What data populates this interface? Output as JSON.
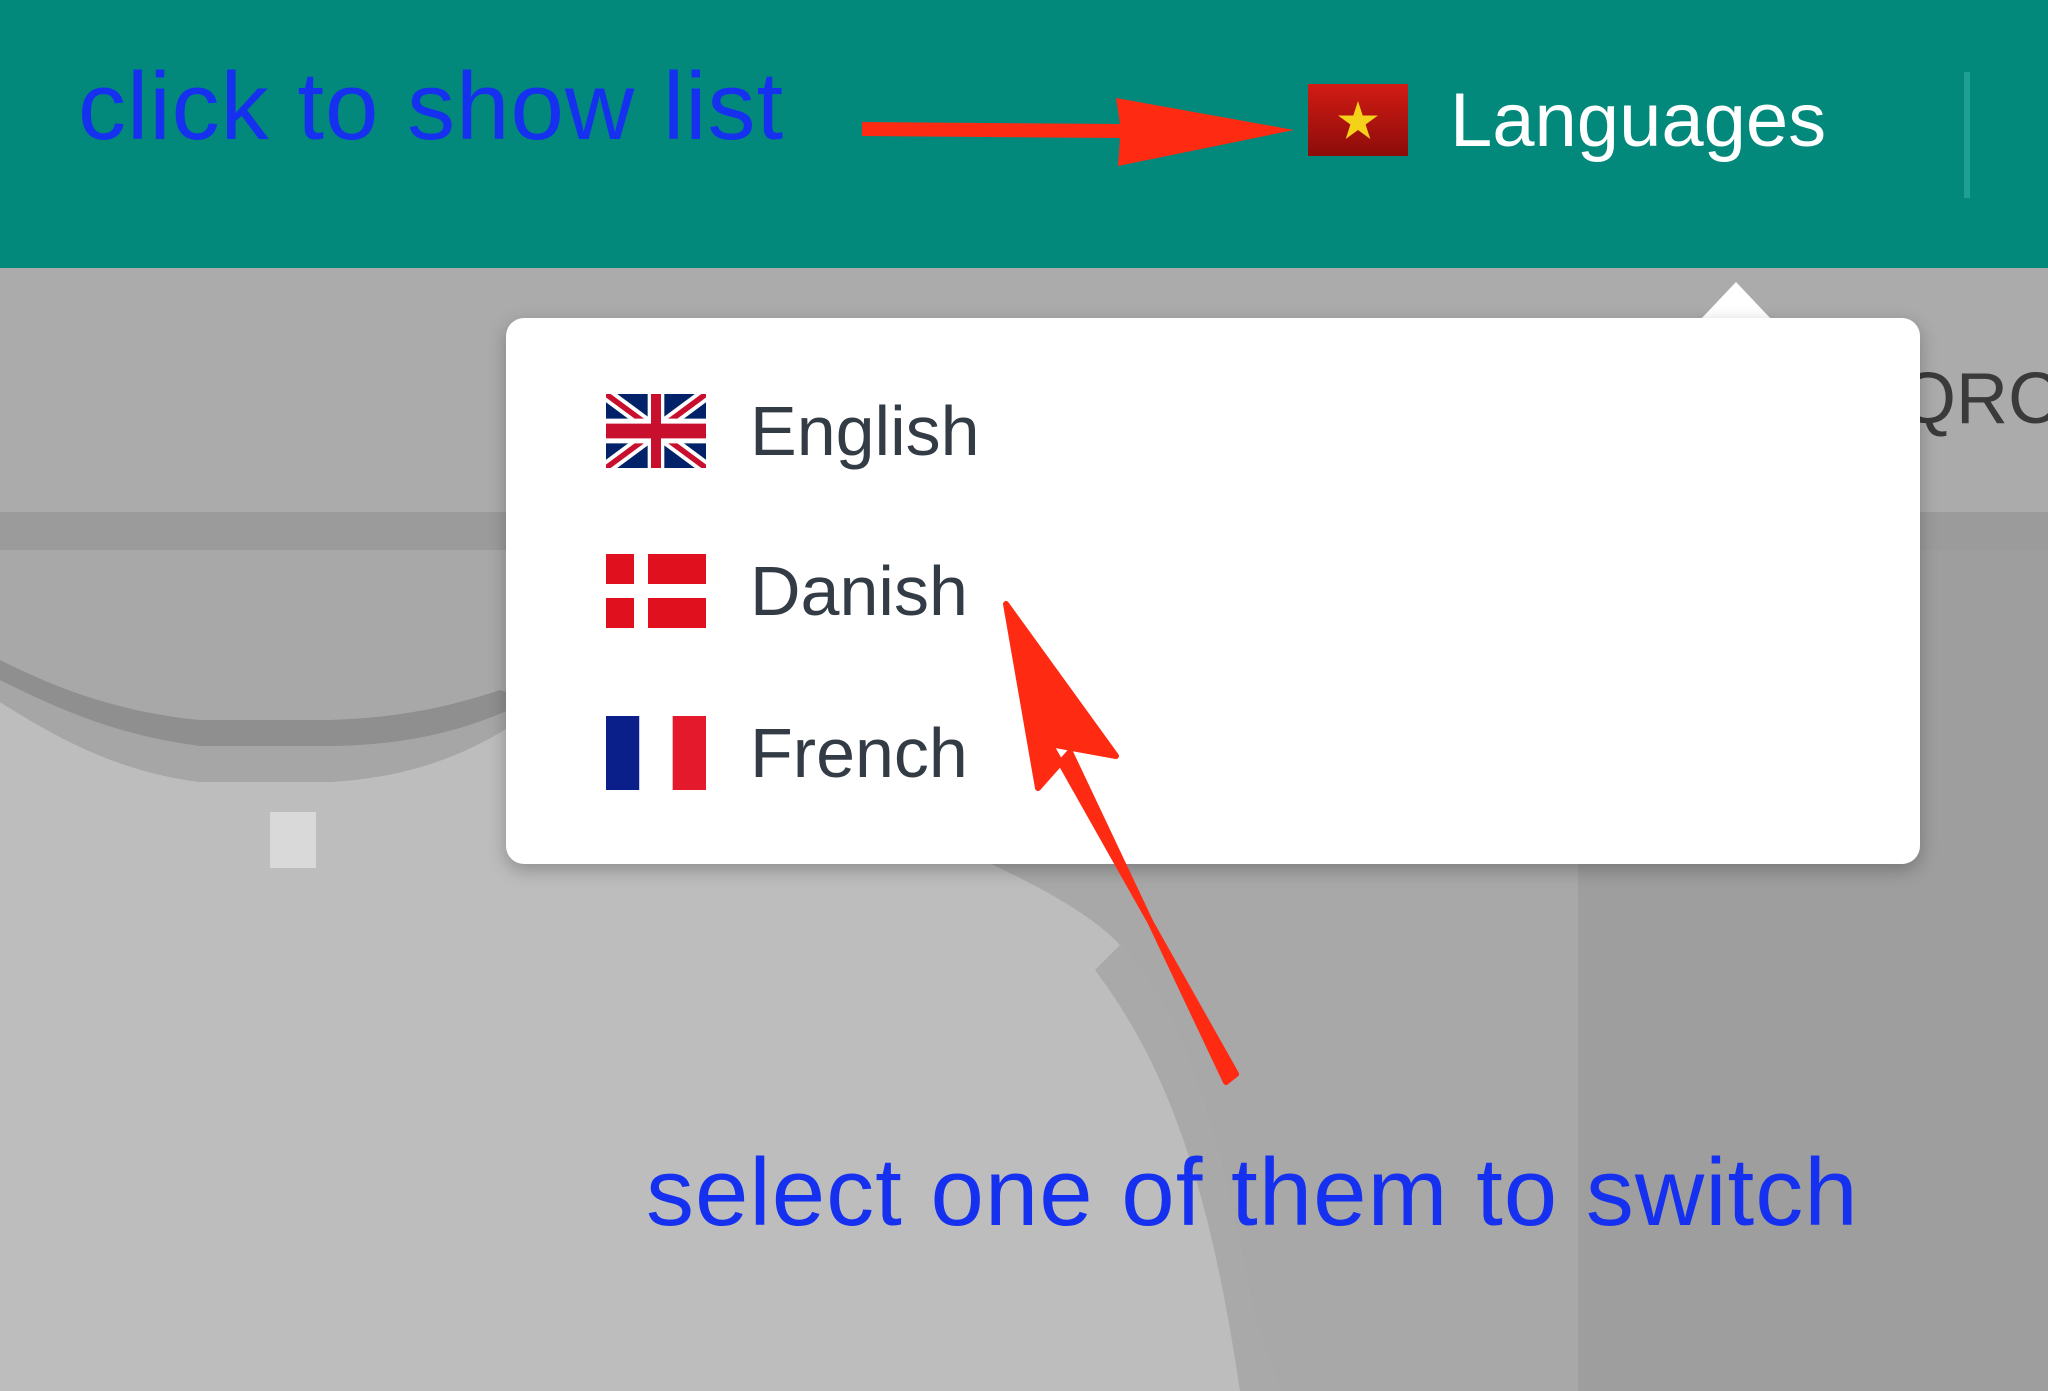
{
  "header": {
    "language_button_label": "Languages",
    "current_flag": "vietnam-flag-icon"
  },
  "subbar": {
    "partial_text": "QRC"
  },
  "language_menu": {
    "items": [
      {
        "label": "English",
        "icon": "uk-flag-icon"
      },
      {
        "label": "Danish",
        "icon": "denmark-flag-icon"
      },
      {
        "label": "French",
        "icon": "france-flag-icon"
      }
    ]
  },
  "annotations": {
    "top": "click to show list",
    "bottom": "select one of them to switch"
  },
  "colors": {
    "header_bg": "#03897b",
    "annotation_text": "#1531ef",
    "arrow": "#ff2a12"
  }
}
